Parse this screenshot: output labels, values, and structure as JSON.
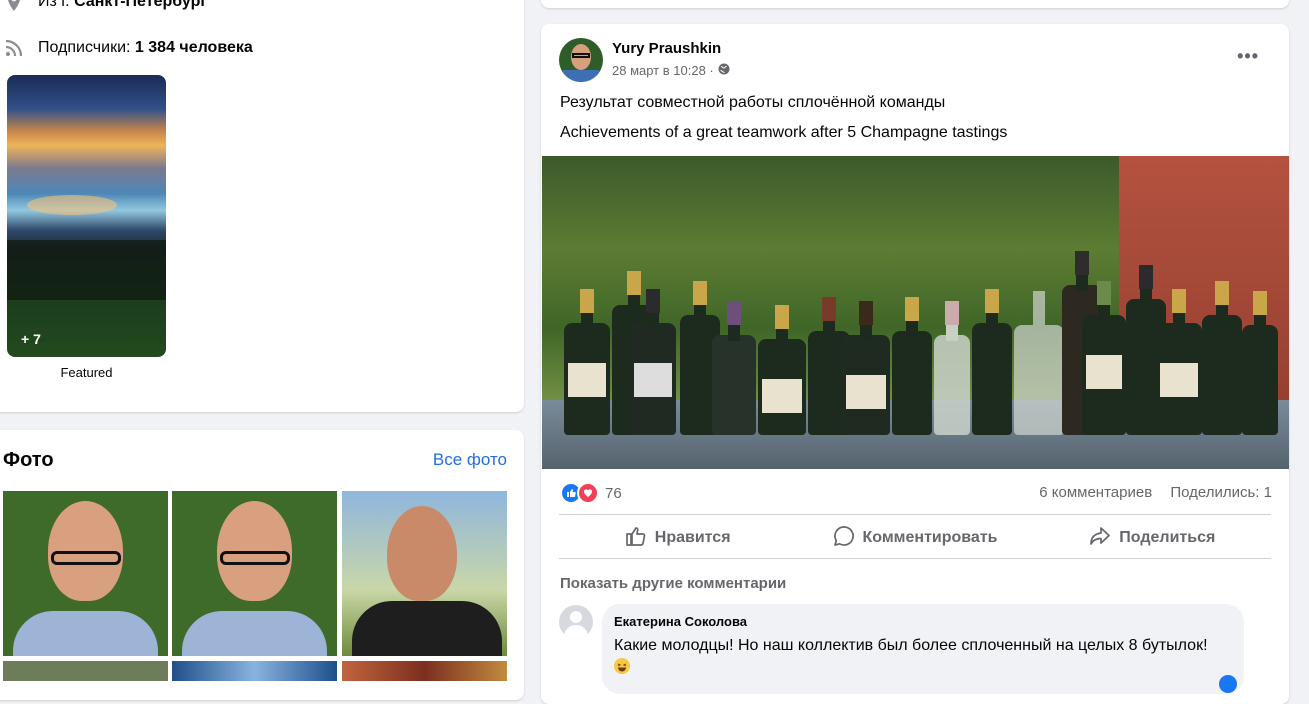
{
  "intro": {
    "from_prefix": "Из г. ",
    "from_city": "Санкт-Петербург",
    "followers_prefix": "Подписчики: ",
    "followers_count": "1 384 человека",
    "featured_more": "+ 7",
    "featured_label": "Featured"
  },
  "photos": {
    "title": "Фото",
    "all_link": "Все фото"
  },
  "post": {
    "author": "Yury Praushkin",
    "date": "28 март в 10:28 ·",
    "more": "•••",
    "text_ru": "Результат совместной работы сплочённой команды",
    "text_en": "Achievements of a great teamwork after 5 Champagne tastings",
    "reaction_count": "76",
    "comments_count": "6 комментариев",
    "shares": "Поделились: 1",
    "like_label": "Нравится",
    "comment_label": "Комментировать",
    "share_label": "Поделиться",
    "show_more_comments": "Показать другие комментарии"
  },
  "comment": {
    "author": "Екатерина Соколова",
    "text": "Какие молодцы! Но наш коллектив был более сплоченный на целых 8 бутылок!"
  },
  "colors": {
    "link": "#216fdb",
    "like_blue": "#1877f2",
    "love_red": "#f33e58"
  }
}
